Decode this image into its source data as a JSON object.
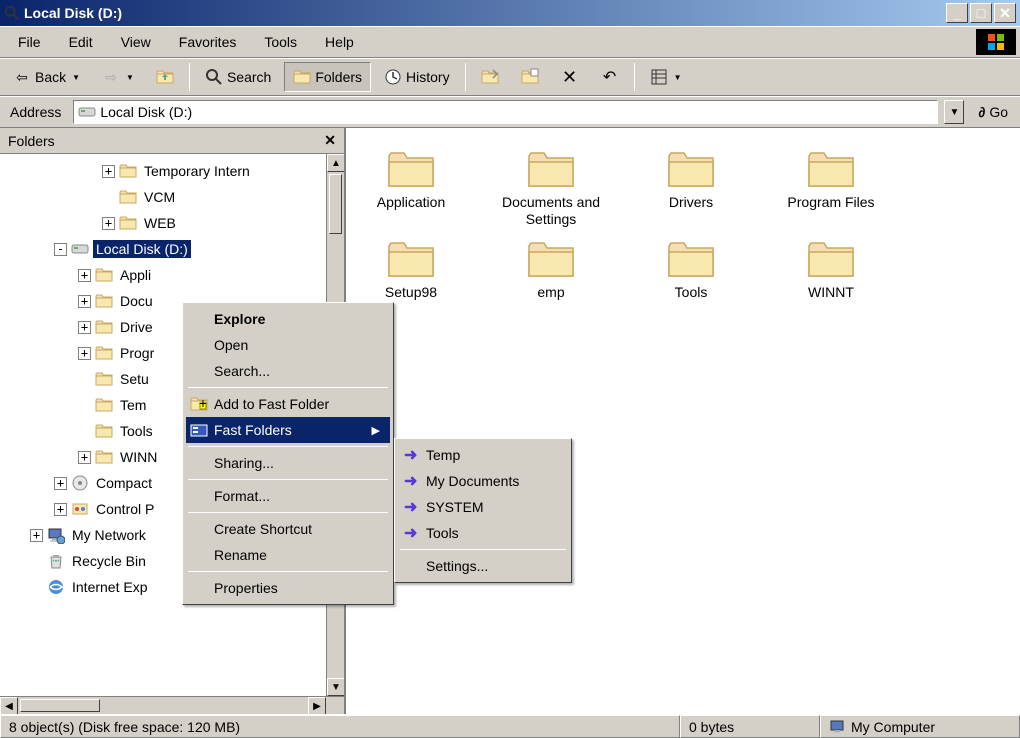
{
  "window": {
    "title": "Local Disk (D:)"
  },
  "menubar": [
    "File",
    "Edit",
    "View",
    "Favorites",
    "Tools",
    "Help"
  ],
  "toolbar": {
    "back": "Back",
    "search": "Search",
    "folders": "Folders",
    "history": "History"
  },
  "addressbar": {
    "label": "Address",
    "value": "Local Disk (D:)",
    "go": "Go"
  },
  "folders_pane": {
    "title": "Folders",
    "tree": [
      {
        "indent": 3,
        "plus": "+",
        "icon": "folder",
        "label": "Temporary Intern"
      },
      {
        "indent": 3,
        "plus": "",
        "icon": "folder",
        "label": "VCM"
      },
      {
        "indent": 3,
        "plus": "+",
        "icon": "folder",
        "label": "WEB"
      },
      {
        "indent": 1,
        "plus": "-",
        "icon": "disk",
        "label": "Local Disk (D:)",
        "selected": true
      },
      {
        "indent": 2,
        "plus": "+",
        "icon": "folder",
        "label": "Appli"
      },
      {
        "indent": 2,
        "plus": "+",
        "icon": "folder",
        "label": "Docu"
      },
      {
        "indent": 2,
        "plus": "+",
        "icon": "folder",
        "label": "Drive"
      },
      {
        "indent": 2,
        "plus": "+",
        "icon": "folder",
        "label": "Progr"
      },
      {
        "indent": 2,
        "plus": "",
        "icon": "folder",
        "label": "Setu"
      },
      {
        "indent": 2,
        "plus": "",
        "icon": "folder",
        "label": "Tem"
      },
      {
        "indent": 2,
        "plus": "",
        "icon": "folder",
        "label": "Tools"
      },
      {
        "indent": 2,
        "plus": "+",
        "icon": "folder",
        "label": "WINN"
      },
      {
        "indent": 1,
        "plus": "+",
        "icon": "cd",
        "label": "Compact"
      },
      {
        "indent": 1,
        "plus": "+",
        "icon": "control",
        "label": "Control P"
      },
      {
        "indent": 0,
        "plus": "+",
        "icon": "network",
        "label": "My Network"
      },
      {
        "indent": 0,
        "plus": "",
        "icon": "recycle",
        "label": "Recycle Bin"
      },
      {
        "indent": 0,
        "plus": "",
        "icon": "ie",
        "label": "Internet Exp"
      }
    ]
  },
  "content_folders": [
    "Application",
    "Documents and Settings",
    "Drivers",
    "Program Files",
    "Setup98",
    "emp",
    "Tools",
    "WINNT"
  ],
  "context_menu": {
    "items": [
      {
        "label": "Explore",
        "bold": true
      },
      {
        "label": "Open"
      },
      {
        "label": "Search..."
      },
      {
        "sep": true
      },
      {
        "label": "Add to Fast Folder",
        "icon": "addfolder"
      },
      {
        "label": "Fast Folders",
        "icon": "fastfolder",
        "highlighted": true,
        "submenu": true
      },
      {
        "sep": true
      },
      {
        "label": "Sharing..."
      },
      {
        "sep": true
      },
      {
        "label": "Format..."
      },
      {
        "sep": true
      },
      {
        "label": "Create Shortcut"
      },
      {
        "label": "Rename"
      },
      {
        "sep": true
      },
      {
        "label": "Properties"
      }
    ],
    "submenu": [
      {
        "label": "Temp",
        "arrow": true
      },
      {
        "label": "My Documents",
        "arrow": true
      },
      {
        "label": "SYSTEM",
        "arrow": true
      },
      {
        "label": "Tools",
        "arrow": true
      },
      {
        "sep": true
      },
      {
        "label": "Settings..."
      }
    ]
  },
  "statusbar": {
    "objects": "8 object(s) (Disk free space: 120 MB)",
    "bytes": "0 bytes",
    "location": "My Computer"
  }
}
